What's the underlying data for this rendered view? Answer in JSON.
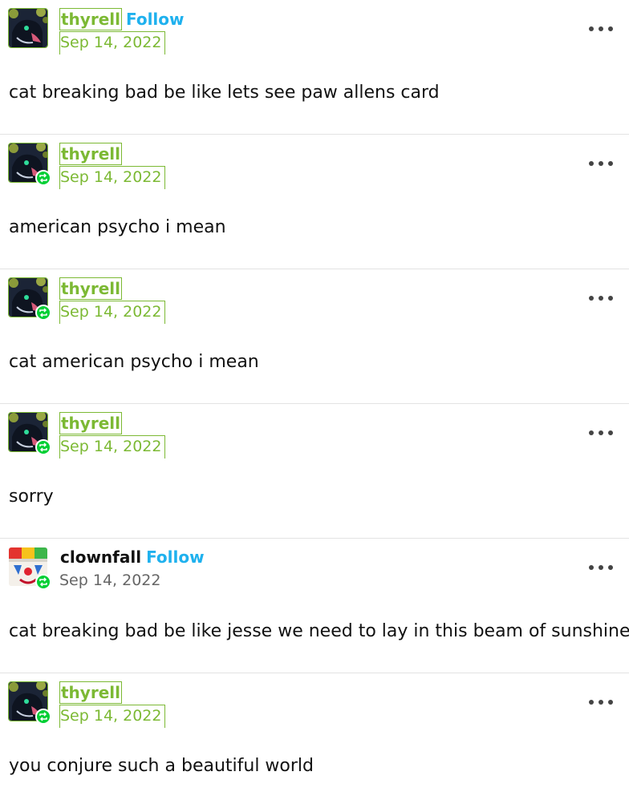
{
  "colors": {
    "accent_green": "#7cb934",
    "follow_blue": "#1fb1ee",
    "reblog_badge": "#01cf35"
  },
  "posts": [
    {
      "username": "thyrell",
      "follow_label": "Follow",
      "date": "Sep 14, 2022",
      "text": "cat breaking bad be like lets see paw allens card",
      "avatar": "dragon-avatar",
      "reblogged": false
    },
    {
      "username": "thyrell",
      "date": "Sep 14, 2022",
      "text": "american psycho i mean",
      "avatar": "dragon-avatar",
      "reblogged": true
    },
    {
      "username": "thyrell",
      "date": "Sep 14, 2022",
      "text": "cat american psycho i mean",
      "avatar": "dragon-avatar",
      "reblogged": true
    },
    {
      "username": "thyrell",
      "date": "Sep 14, 2022",
      "text": "sorry",
      "avatar": "dragon-avatar",
      "reblogged": true
    },
    {
      "username": "clownfall",
      "follow_label": "Follow",
      "date": "Sep 14, 2022",
      "text": "cat breaking bad be like jesse we need to lay in this beam of sunshine",
      "avatar": "clown-avatar",
      "reblogged": true
    },
    {
      "username": "thyrell",
      "date": "Sep 14, 2022",
      "text": "you conjure such a beautiful world",
      "avatar": "dragon-avatar",
      "reblogged": true
    }
  ]
}
